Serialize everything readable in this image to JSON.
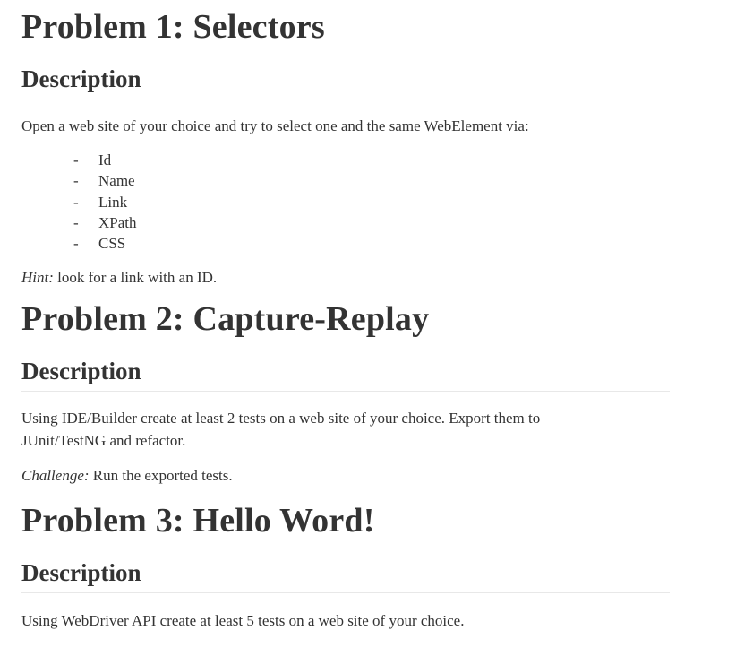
{
  "problem1": {
    "title": "Problem 1: Selectors",
    "description_heading": "Description",
    "text": "Open a web site of your choice and try to select one and the same WebElement via:",
    "list_items": [
      "Id",
      "Name",
      "Link",
      "XPath",
      "CSS"
    ],
    "bullet": "-",
    "hint_label": "Hint:",
    "hint_text": " look for a link with an ID."
  },
  "problem2": {
    "title": "Problem 2: Capture-Replay",
    "description_heading": "Description",
    "text": "Using IDE/Builder create at least 2 tests on a web site of your choice. Export them to JUnit/TestNG and refactor.",
    "challenge_label": "Challenge:",
    "challenge_text": " Run the exported tests."
  },
  "problem3": {
    "title": "Problem 3: Hello Word!",
    "description_heading": "Description",
    "text": "Using WebDriver API create at least 5 tests on a web site of your choice."
  }
}
